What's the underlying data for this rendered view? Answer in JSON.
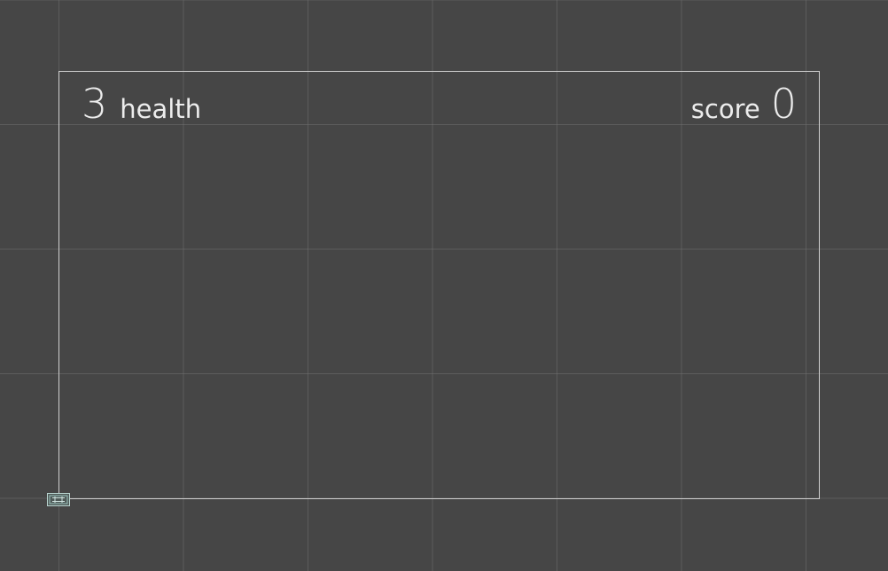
{
  "hud": {
    "health_value": "3",
    "health_label": "health",
    "score_label": "score",
    "score_value": "0"
  },
  "colors": {
    "background": "#464646",
    "grid_line": "#6e6e6e",
    "frame_border": "#cfcfcf",
    "text": "#ececec",
    "handle_accent": "#9ec6c0"
  },
  "icons": {
    "rect_transform_handle": "rect-transform-handle-icon"
  }
}
